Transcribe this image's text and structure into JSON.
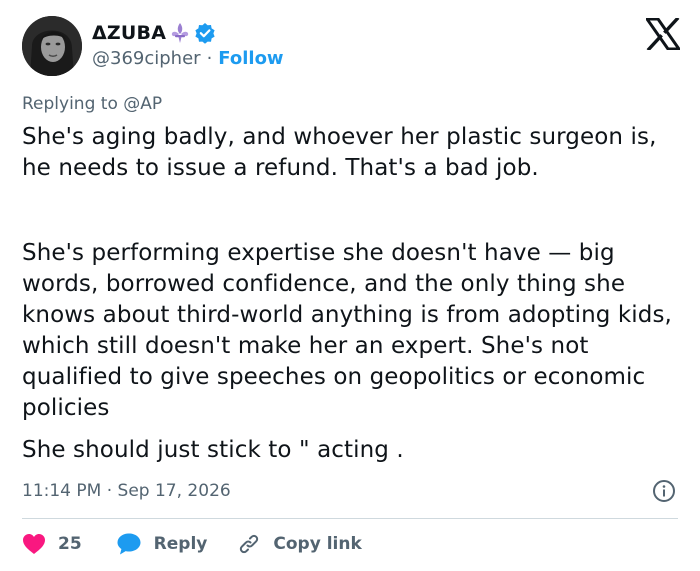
{
  "author": {
    "display_name": "ΔZUBA",
    "handle": "@369cipher",
    "separator": "·",
    "follow_label": "Follow"
  },
  "icons": {
    "decoration": "fleur-de-lis-icon",
    "verified": "verified-badge-icon",
    "platform": "x-logo-icon",
    "info": "info-icon",
    "like": "heart-icon",
    "reply": "reply-bubble-icon",
    "copy": "link-icon"
  },
  "colors": {
    "accent": "#1d9bf0",
    "like": "#f91880",
    "muted": "#536471",
    "text": "#0f1419",
    "fleur": "#9b7fd1"
  },
  "reply_context": {
    "prefix": "Replying to",
    "target": "@AP"
  },
  "tweet": {
    "paragraphs": [
      "She's aging badly, and whoever her plastic surgeon is, he needs to issue a refund. That's a bad job.",
      "She's performing expertise she doesn't have — big words, borrowed confidence, and the only thing she knows about third-world anything is from adopting kids, which still doesn't make her an expert. She's not qualified to give speeches on geopolitics or economic policies",
      "She should just stick to \" acting ."
    ]
  },
  "meta": {
    "time": "11:14 PM",
    "separator": "·",
    "date": "Sep 17, 2026"
  },
  "actions": {
    "like_count": "25",
    "reply_label": "Reply",
    "copy_label": "Copy link"
  }
}
